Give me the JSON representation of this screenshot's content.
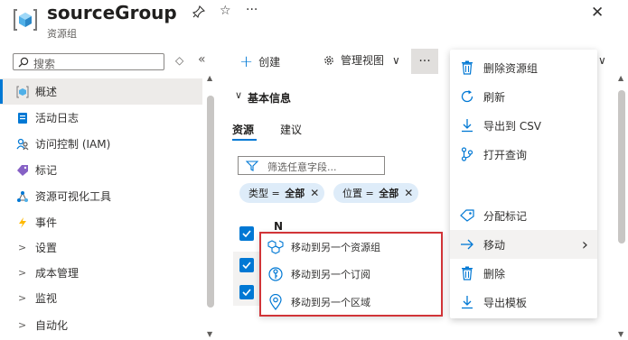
{
  "header": {
    "title": "sourceGroup",
    "subtitle": "资源组",
    "pin": "⚲",
    "star": "☆",
    "more": "···",
    "close": "✕"
  },
  "sidebar": {
    "search_placeholder": "搜索",
    "sort_glyph": "◇",
    "collapse_glyph": "«",
    "items": [
      {
        "label": "概述",
        "icon": "resource-group-icon"
      },
      {
        "label": "活动日志",
        "icon": "activity-log-icon"
      },
      {
        "label": "访问控制 (IAM)",
        "icon": "people-icon"
      },
      {
        "label": "标记",
        "icon": "tag-icon"
      },
      {
        "label": "资源可视化工具",
        "icon": "visualizer-icon"
      },
      {
        "label": "事件",
        "icon": "lightning-icon"
      },
      {
        "label": "设置",
        "icon": "chevron-right-icon"
      },
      {
        "label": "成本管理",
        "icon": "chevron-right-icon"
      },
      {
        "label": "监视",
        "icon": "chevron-right-icon"
      },
      {
        "label": "自动化",
        "icon": "chevron-right-icon"
      }
    ]
  },
  "toolbar": {
    "create": "创建",
    "manage_view": "管理视图",
    "more": "···",
    "chevron": "∨"
  },
  "content": {
    "section_title": "基本信息",
    "tabs": [
      "资源",
      "建议"
    ],
    "filter_placeholder": "筛选任意字段...",
    "pills": [
      {
        "key": "类型",
        "eq": " = ",
        "value": "全部"
      },
      {
        "key": "位置",
        "eq": " = ",
        "value": "全部"
      }
    ],
    "partial_row_text": "N"
  },
  "more_menu": {
    "items": [
      {
        "label": "删除资源组",
        "icon": "trash-icon"
      },
      {
        "label": "刷新",
        "icon": "refresh-icon"
      },
      {
        "label": "导出到 CSV",
        "icon": "download-icon"
      },
      {
        "label": "打开查询",
        "icon": "query-icon"
      },
      {
        "label": "分配标记",
        "icon": "tag-icon"
      },
      {
        "label": "移动",
        "icon": "arrow-right-icon"
      },
      {
        "label": "删除",
        "icon": "trash-icon"
      },
      {
        "label": "导出模板",
        "icon": "download-icon"
      }
    ],
    "submenu_chevron": "›"
  },
  "move_submenu": {
    "items": [
      {
        "label": "移动到另一个资源组",
        "icon": "cubes-icon"
      },
      {
        "label": "移动到另一个订阅",
        "icon": "key-icon"
      },
      {
        "label": "移动到另一个区域",
        "icon": "location-icon"
      }
    ]
  },
  "colors": {
    "accent": "#0078d4",
    "highlight_border": "#d13438",
    "selected_bg": "#edebe9",
    "pill_bg": "#deecf9"
  }
}
